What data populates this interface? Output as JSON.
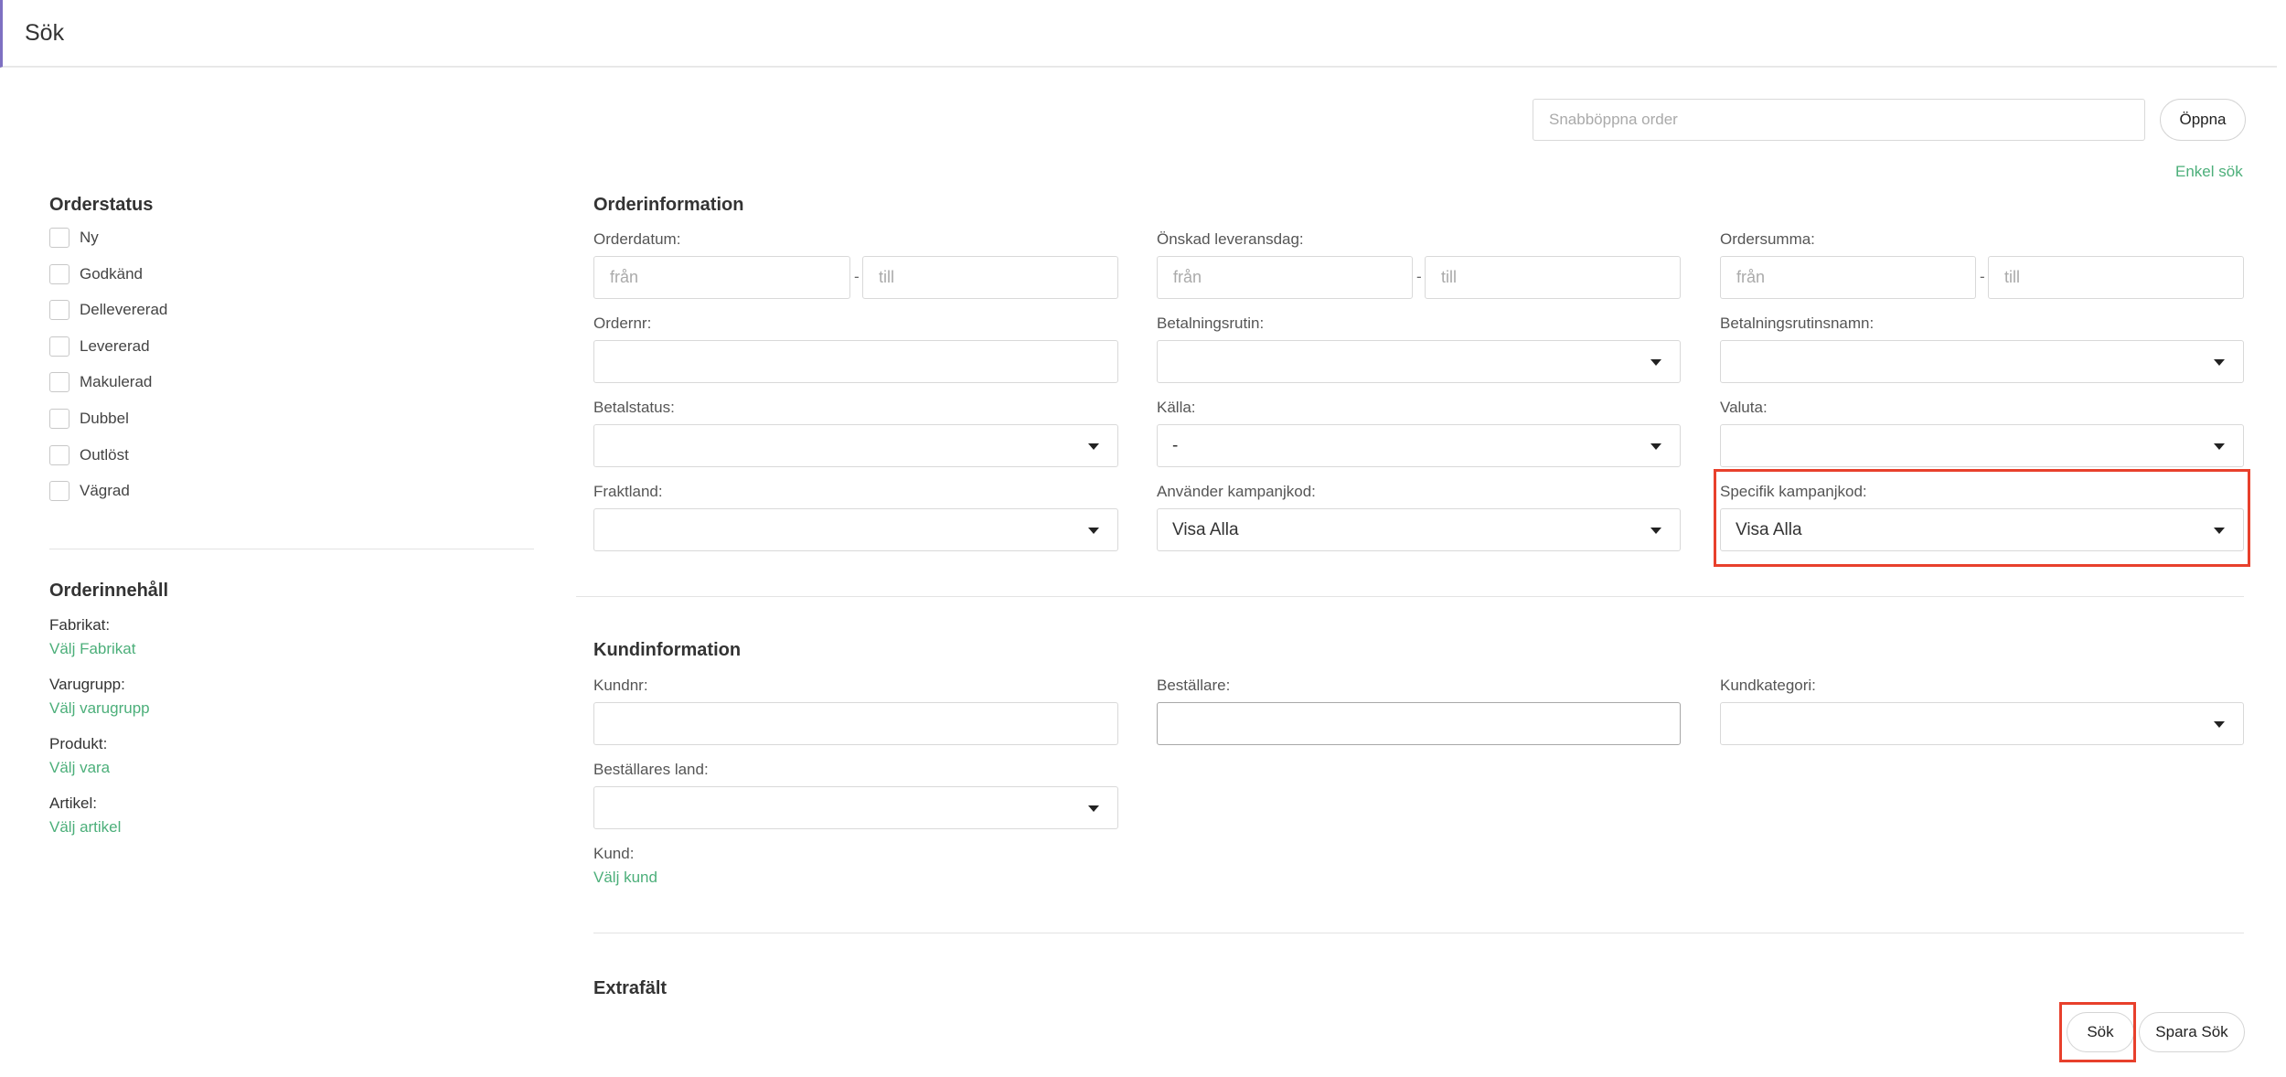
{
  "header": {
    "title": "Sök"
  },
  "quick_open": {
    "placeholder": "Snabböppna order",
    "button": "Öppna"
  },
  "simple_search_link": "Enkel sök",
  "order_status": {
    "title": "Orderstatus",
    "items": [
      "Ny",
      "Godkänd",
      "Dellevererad",
      "Levererad",
      "Makulerad",
      "Dubbel",
      "Outlöst",
      "Vägrad"
    ]
  },
  "order_content": {
    "title": "Orderinnehåll",
    "fields": [
      {
        "label": "Fabrikat:",
        "link": "Välj Fabrikat"
      },
      {
        "label": "Varugrupp:",
        "link": "Välj varugrupp"
      },
      {
        "label": "Produkt:",
        "link": "Välj vara"
      },
      {
        "label": "Artikel:",
        "link": "Välj artikel"
      }
    ]
  },
  "order_info": {
    "title": "Orderinformation",
    "order_date": {
      "label": "Orderdatum:",
      "from": "från",
      "to": "till",
      "sep": "-"
    },
    "delivery_date": {
      "label": "Önskad leveransdag:",
      "from": "från",
      "to": "till",
      "sep": "-"
    },
    "order_sum": {
      "label": "Ordersumma:",
      "from": "från",
      "to": "till",
      "sep": "-"
    },
    "order_nr": {
      "label": "Ordernr:",
      "value": ""
    },
    "payment_routine": {
      "label": "Betalningsrutin:",
      "value": ""
    },
    "payment_routine_name": {
      "label": "Betalningsrutinsnamn:",
      "value": ""
    },
    "payment_status": {
      "label": "Betalstatus:",
      "value": ""
    },
    "source": {
      "label": "Källa:",
      "value": "-"
    },
    "currency": {
      "label": "Valuta:",
      "value": ""
    },
    "shipping_country": {
      "label": "Fraktland:",
      "value": ""
    },
    "uses_campaign_code": {
      "label": "Använder kampanjkod:",
      "value": "Visa Alla"
    },
    "specific_campaign_code": {
      "label": "Specifik kampanjkod:",
      "value": "Visa Alla"
    }
  },
  "customer_info": {
    "title": "Kundinformation",
    "customer_nr": {
      "label": "Kundnr:",
      "value": ""
    },
    "orderer": {
      "label": "Beställare:",
      "value": ""
    },
    "customer_category": {
      "label": "Kundkategori:",
      "value": ""
    },
    "orderer_country": {
      "label": "Beställares land:",
      "value": ""
    },
    "customer": {
      "label": "Kund:",
      "link": "Välj kund"
    }
  },
  "extra_fields": {
    "title": "Extrafält"
  },
  "actions": {
    "search": "Sök",
    "save_search": "Spara Sök"
  },
  "colors": {
    "accent_link": "#4caf7a",
    "highlight": "#e8402c",
    "header_accent": "#7e70c2"
  }
}
